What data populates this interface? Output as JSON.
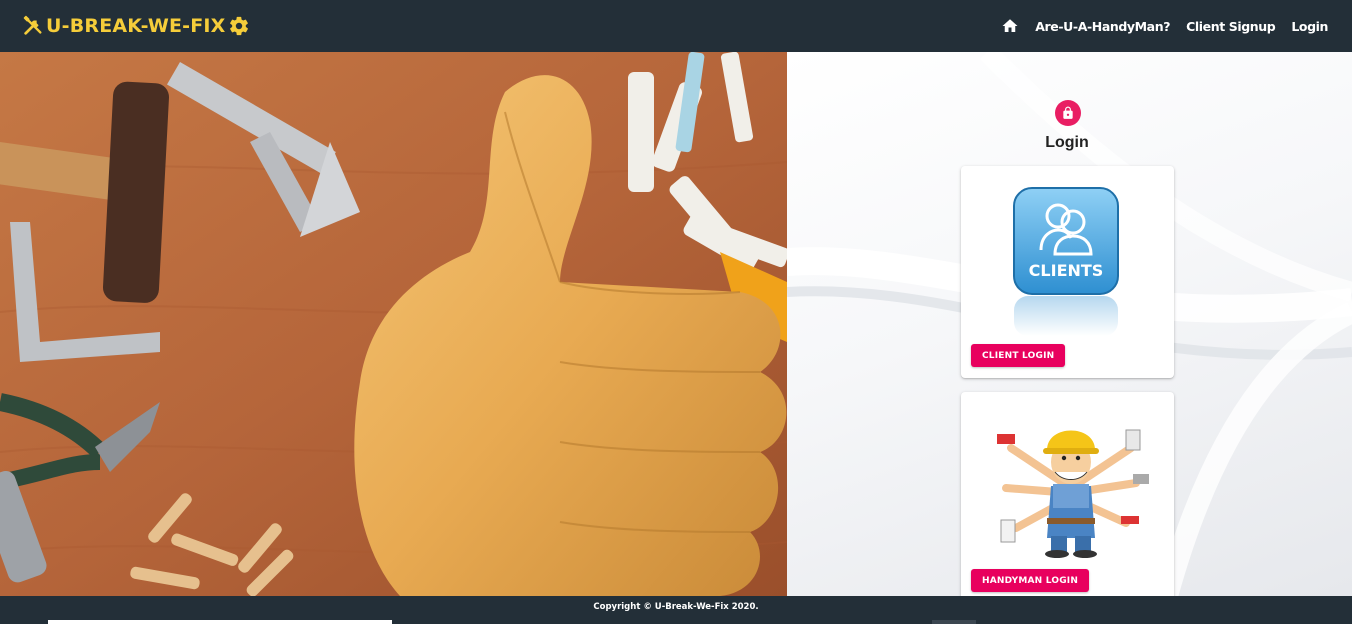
{
  "brand": {
    "title": "U-BREAK-WE-FIX",
    "left_icon": "tools-icon",
    "right_icon": "gear-icon",
    "color": "#f5cd3a"
  },
  "nav": {
    "home_icon": "home-icon",
    "items": [
      {
        "label": "Are-U-A-HandyMan?"
      },
      {
        "label": "Client Signup"
      },
      {
        "label": "Login"
      }
    ]
  },
  "hero": {
    "image": "thumbs-up-glove-with-tools-photo"
  },
  "login": {
    "icon": "lock-icon",
    "title": "Login",
    "accent": "#e8005e",
    "cards": [
      {
        "image_label": "CLIENTS",
        "image": "clients-icon",
        "button": "CLIENT LOGIN"
      },
      {
        "image": "handyman-illustration",
        "button": "HANDYMAN LOGIN"
      }
    ]
  },
  "footer": {
    "copyright": "Copyright © U-Break-We-Fix 2020."
  },
  "colors": {
    "appbar": "#232f38",
    "accent": "#e8005e",
    "brand": "#f5cd3a"
  }
}
